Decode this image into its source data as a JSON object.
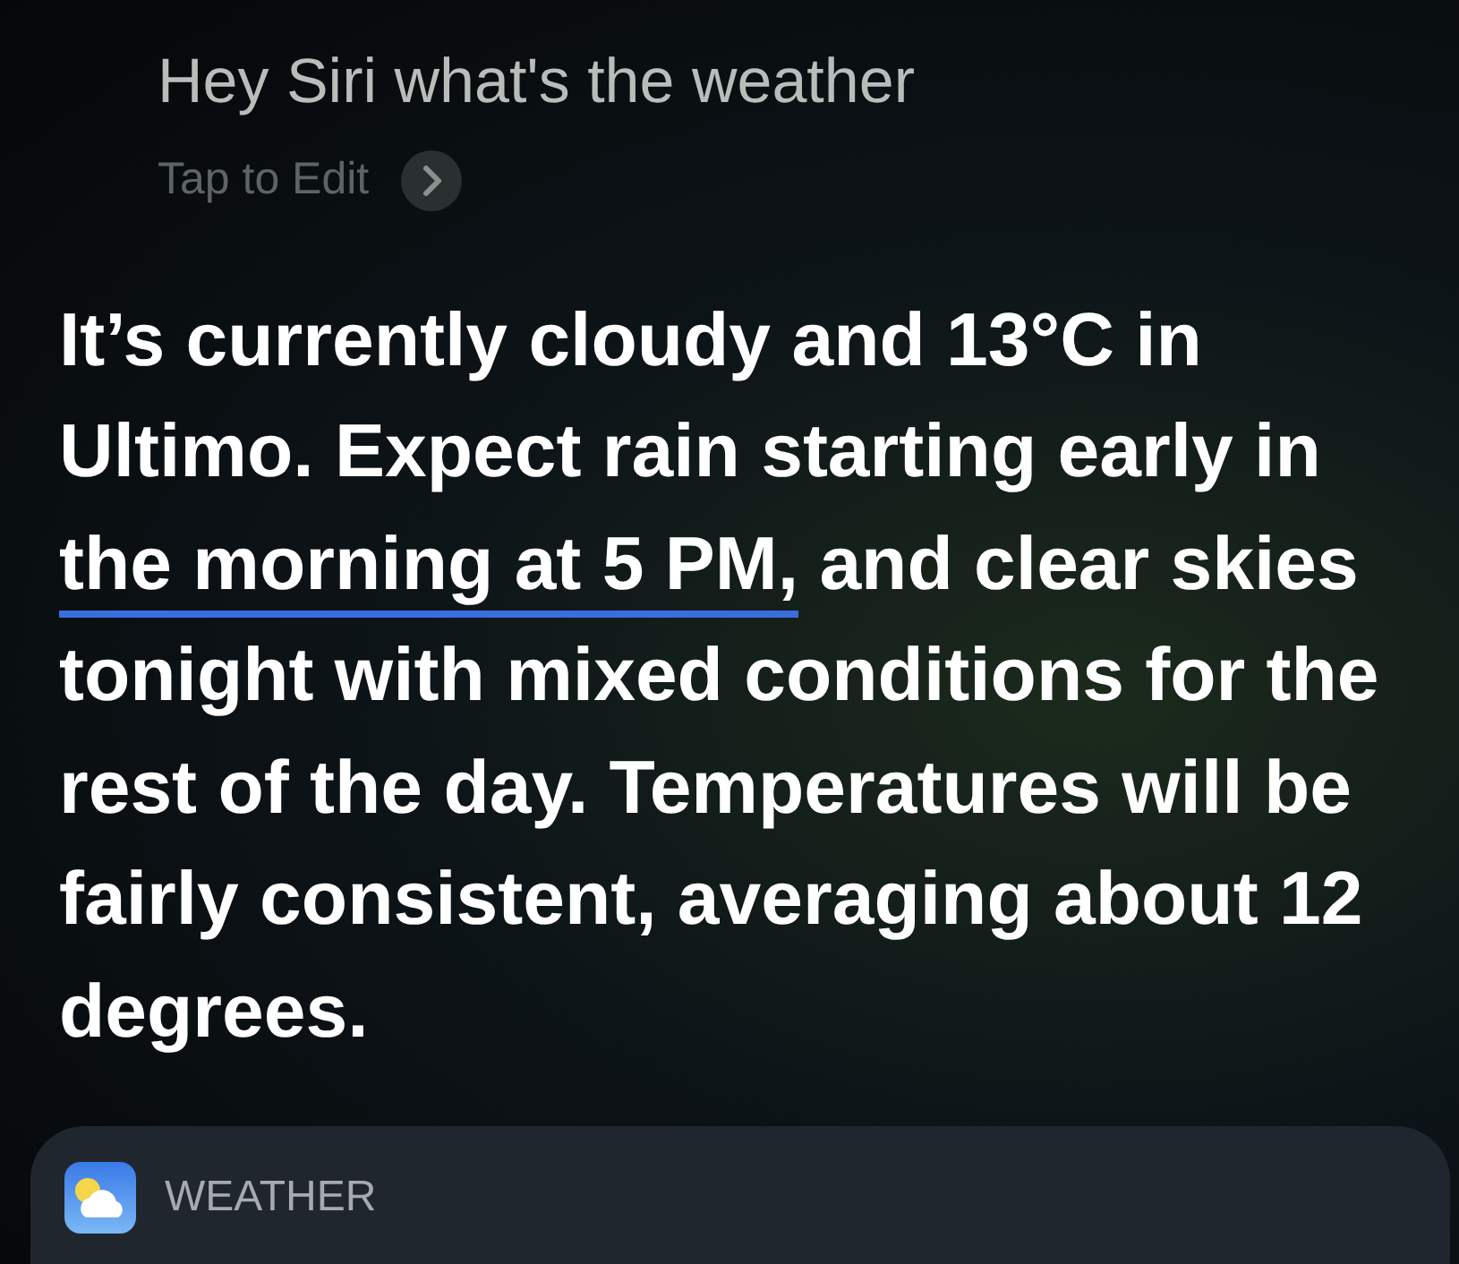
{
  "query": {
    "text": "Hey Siri what's the weather",
    "edit_label": "Tap to Edit"
  },
  "response": {
    "segments": [
      {
        "text": "It’s currently cloudy and 13°C in Ultimo. Expect rain starting early in ",
        "underlined": false
      },
      {
        "text": "the morning at 5 PM,",
        "underlined": true
      },
      {
        "text": " and clear skies tonight with mixed conditions for the rest of the day. Temperatures will be fairly consistent, averaging about 12 degrees.",
        "underlined": false
      }
    ]
  },
  "card": {
    "app_name": "WEATHER"
  }
}
